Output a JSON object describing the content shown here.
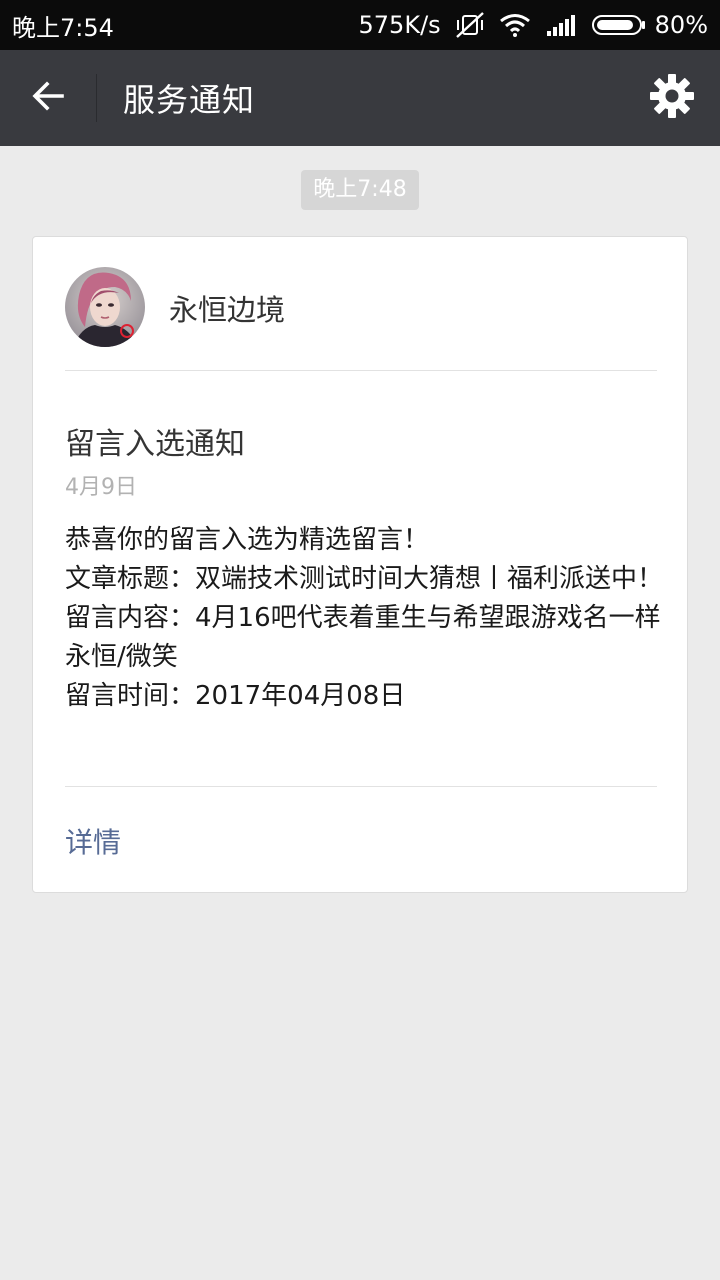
{
  "status_bar": {
    "time": "晚上7:54",
    "net_speed": "575K/s",
    "battery": "80%",
    "icons": [
      "mute-vibrate-icon",
      "wifi-icon",
      "signal-icon",
      "battery-icon"
    ]
  },
  "header": {
    "title": "服务通知",
    "back_icon": "arrow-left-icon",
    "settings_icon": "gear-icon"
  },
  "message_time": "晚上7:48",
  "card": {
    "sender": "永恒边境",
    "title": "留言入选通知",
    "date": "4月9日",
    "body": {
      "line1": "恭喜你的留言入选为精选留言！",
      "line2": "文章标题：双端技术测试时间大猜想丨福利派送中！",
      "line3": "留言内容：4月16吧代表着重生与希望跟游戏名一样永恒/微笑",
      "line4": "留言时间：2017年04月08日"
    },
    "details": "详情"
  },
  "colors": {
    "header_bg": "#393a3f",
    "page_bg": "#ebebeb",
    "link": "#576b95"
  }
}
